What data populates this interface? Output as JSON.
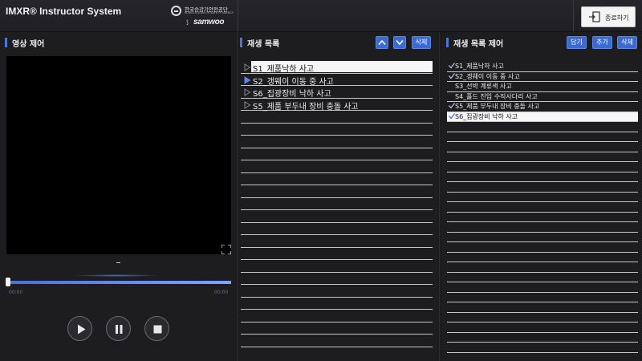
{
  "app": {
    "title": "IMXR® Instructor System",
    "logo_kosha_name": "한국승강기안전공단",
    "logo_kosha_sub": "KOREA ELEVATOR SAFETY AGENCY",
    "logo_samwoo": "samwoo",
    "exit_label": "종료하기"
  },
  "video_panel": {
    "title": "영상 제어",
    "time_current": "00:00",
    "time_total": "00:00",
    "progress": 0.0
  },
  "playlist_panel": {
    "title": "재생 목록",
    "delete_label": "삭제",
    "items": [
      {
        "label": "S1_제품낙하 사고",
        "selected": true
      },
      {
        "label": "S2_갱웨이 이동 중 사고",
        "selected": false
      },
      {
        "label": "S6_집광장비 낙하 사고",
        "selected": false
      },
      {
        "label": "S5_제품 부두내 장비 충돌 사고",
        "selected": false
      }
    ]
  },
  "manage_panel": {
    "title": "재생 목록 제어",
    "add_label": "담기",
    "append_label": "추가",
    "delete_label": "삭제",
    "items": [
      {
        "label": "S1_제품낙하 사고",
        "checked": true,
        "selected": false
      },
      {
        "label": "S2_갱웨이 이동 중 사고",
        "checked": true,
        "selected": false
      },
      {
        "label": "S3_선박 계류색 사고",
        "checked": false,
        "selected": false
      },
      {
        "label": "S4_홀드 진입 수직사다리 사고",
        "checked": false,
        "selected": false
      },
      {
        "label": "S5_제품 부두내 장비 충돌 사고",
        "checked": true,
        "selected": false
      },
      {
        "label": "S6_집광장비 낙하 사고",
        "checked": true,
        "selected": true
      }
    ]
  },
  "colors": {
    "accent": "#4a78d8",
    "button": "#3d6ad0",
    "background": "#1d1d20"
  }
}
